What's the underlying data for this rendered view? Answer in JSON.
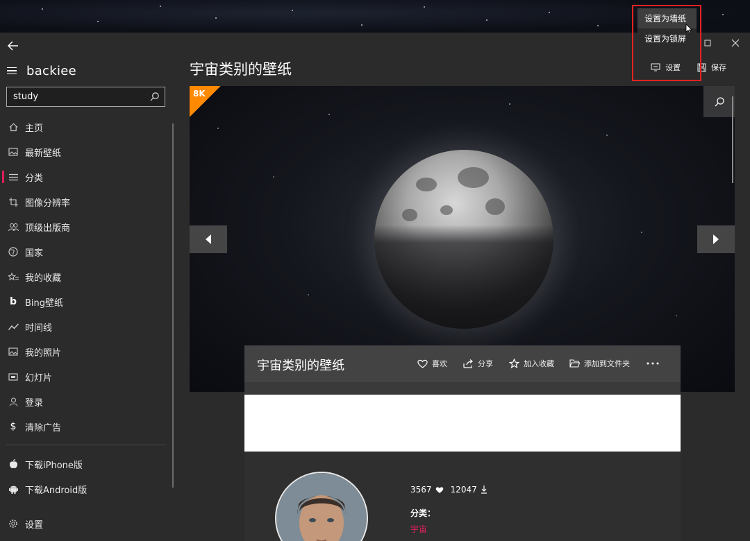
{
  "app": {
    "brand": "backiee"
  },
  "search": {
    "value": "study"
  },
  "sidebar": {
    "items": [
      {
        "label": "主页",
        "icon": "home-icon"
      },
      {
        "label": "最新壁纸",
        "icon": "image-icon"
      },
      {
        "label": "分类",
        "icon": "list-icon",
        "active": true
      },
      {
        "label": "图像分辨率",
        "icon": "crop-icon"
      },
      {
        "label": "顶级出版商",
        "icon": "people-icon"
      },
      {
        "label": "国家",
        "icon": "globe-icon"
      },
      {
        "label": "我的收藏",
        "icon": "star-list-icon"
      },
      {
        "label": "Bing壁纸",
        "icon": "bing-icon"
      },
      {
        "label": "时间线",
        "icon": "trend-icon"
      },
      {
        "label": "我的照片",
        "icon": "photo-icon"
      },
      {
        "label": "幻灯片",
        "icon": "slideshow-icon"
      },
      {
        "label": "登录",
        "icon": "user-icon"
      },
      {
        "label": "清除广告",
        "icon": "dollar-icon"
      }
    ],
    "bottom_items": [
      {
        "label": "下载iPhone版",
        "icon": "apple-icon"
      },
      {
        "label": "下载Android版",
        "icon": "android-icon"
      }
    ],
    "settings_label": "设置"
  },
  "header": {
    "title": "宇宙类别的壁纸",
    "set_label": "设置",
    "save_label": "保存"
  },
  "context_menu": {
    "items": [
      "设置为墙纸",
      "设置为锁屏"
    ]
  },
  "hero": {
    "badge": "8K"
  },
  "info": {
    "title": "宇宙类别的壁纸",
    "actions": {
      "like": "喜欢",
      "share": "分享",
      "favorite": "加入收藏",
      "add_folder": "添加到文件夹"
    }
  },
  "details": {
    "likes": "3567",
    "downloads": "12047",
    "category_label": "分类：",
    "category_value": "宇宙"
  },
  "colors": {
    "accent": "#e0205a",
    "badge": "#ff8a00",
    "highlight": "#e32222"
  }
}
